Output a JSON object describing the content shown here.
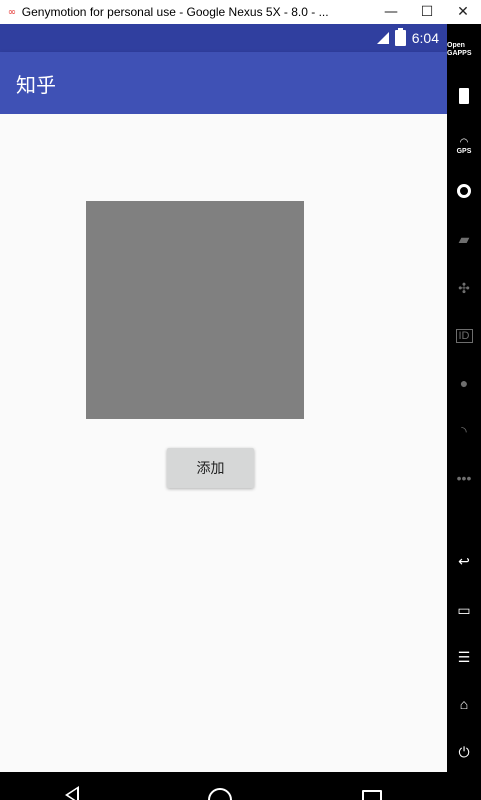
{
  "window": {
    "title": "Genymotion for personal use - Google Nexus 5X - 8.0 - ...",
    "minimize": "—",
    "maximize": "☐",
    "close": "✕"
  },
  "status_bar": {
    "time": "6:04",
    "battery_badge": "!"
  },
  "app_bar": {
    "title": "知乎"
  },
  "main": {
    "add_button_label": "添加"
  },
  "side_toolbar": {
    "open_gapps": "Open GAPPS",
    "gps": "GPS",
    "identifiers": "ID"
  },
  "colors": {
    "status_bar": "#303f9f",
    "app_bar": "#3f51b5",
    "background": "#fafafa",
    "image_placeholder": "#808080",
    "button": "#d6d7d7"
  }
}
